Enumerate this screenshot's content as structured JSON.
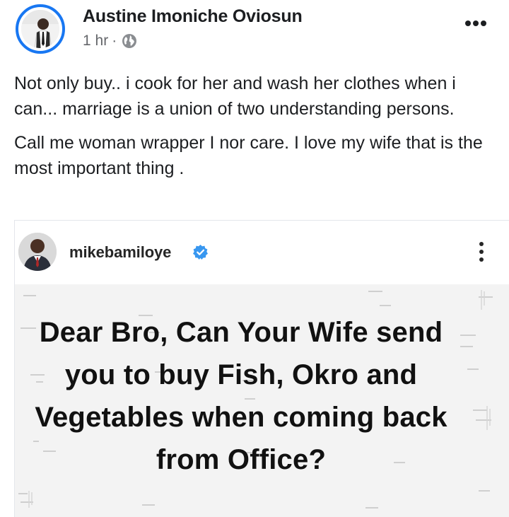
{
  "post": {
    "author": "Austine Imoniche Oviosun",
    "time": "1 hr",
    "separator": "·",
    "paragraphs": [
      "Not only buy.. i cook for her and wash her clothes when i can... marriage is a union of two understanding persons.",
      "Call me woman wrapper I nor care. I love my wife that is the most important thing ."
    ]
  },
  "shared": {
    "username": "mikebamiloye",
    "quote": "Dear Bro, Can Your Wife send you to buy Fish, Okro and Vegetables when coming back from Office?"
  },
  "colors": {
    "accent": "#1877f2",
    "verified": "#3897f0",
    "text": "#1c1e21",
    "muted": "#65676b",
    "card": "#f3f3f3"
  },
  "icons": {
    "audience": "globe-icon",
    "post_menu": "more-horizontal-icon",
    "shared_menu": "more-vertical-icon",
    "verified": "verified-badge-icon"
  }
}
